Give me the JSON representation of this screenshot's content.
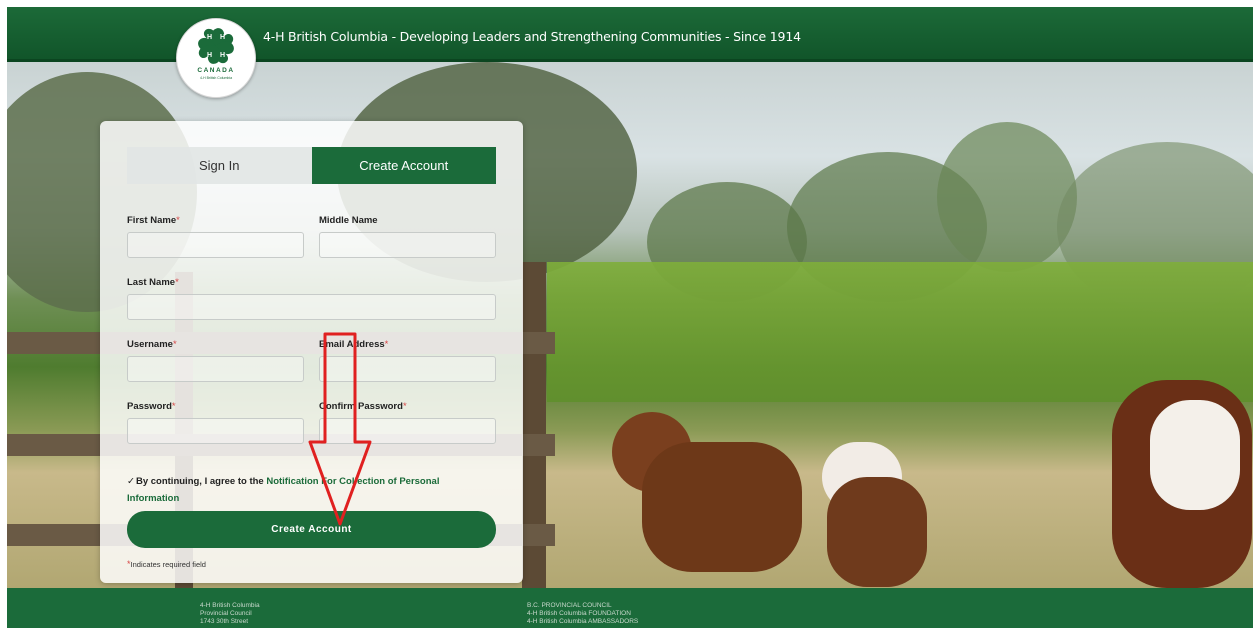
{
  "header": {
    "tagline": "4-H British Columbia - Developing Leaders and Strengthening Communities - Since 1914"
  },
  "logo": {
    "country": "CANADA",
    "subtitle": "4-H British Columbia",
    "icon": "four-leaf-clover-icon"
  },
  "tabs": {
    "sign_in": "Sign In",
    "create_account": "Create Account",
    "active": "create_account"
  },
  "form": {
    "first_name": {
      "label": "First Name",
      "required": "*",
      "value": ""
    },
    "middle_name": {
      "label": "Middle Name",
      "value": ""
    },
    "last_name": {
      "label": "Last Name",
      "required": "*",
      "value": ""
    },
    "username": {
      "label": "Username",
      "required": "*",
      "value": ""
    },
    "email": {
      "label": "Email Address",
      "required": "*",
      "value": ""
    },
    "password": {
      "label": "Password",
      "required": "*",
      "value": ""
    },
    "confirm_password": {
      "label": "Confirm Password",
      "required": "*",
      "value": ""
    },
    "agree_prefix": "By continuing, I agree to the ",
    "agree_link": "Notification For Collection of Personal Information",
    "agree_checked": true,
    "checkbox_mark": "✓",
    "submit_label": "Create Account",
    "required_mark": "*",
    "required_note": "Indicates required field"
  },
  "footer": {
    "col1": [
      "4-H British Columbia",
      "Provincial Council",
      "1743 30th Street"
    ],
    "col2": [
      "B.C. PROVINCIAL COUNCIL",
      "4-H British Columbia FOUNDATION",
      "4-H British Columbia AMBASSADORS"
    ]
  },
  "colors": {
    "brand_green": "#1b6b3a",
    "required_red": "#d64545",
    "annotation_red": "#e02020"
  }
}
